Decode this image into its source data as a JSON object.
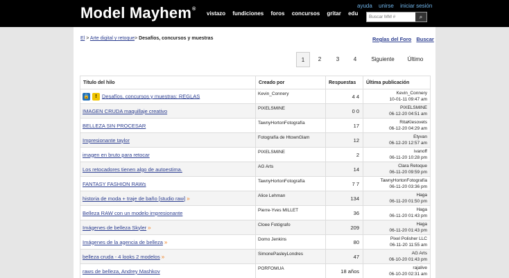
{
  "header": {
    "logo": "Model Mayhem",
    "logo_mark": "®",
    "nav": [
      "vistazo",
      "fundiciones",
      "foros",
      "concursos",
      "gritar",
      "edu"
    ],
    "util": [
      "ayuda",
      "unirse",
      "iniciar sesión"
    ],
    "search_placeholder": "Buscar MM #"
  },
  "breadcrumb": {
    "root": "El",
    "sep": ">",
    "section": "Arte digital y retoque",
    "current": "Desafíos, concursos y muestras"
  },
  "forum_links": {
    "rules": "Reglas del Foro",
    "search": "Buscar"
  },
  "pagination": {
    "pages": [
      "1",
      "2",
      "3",
      "4"
    ],
    "current": "1",
    "next": "Siguiente",
    "last": "Último"
  },
  "table": {
    "headers": {
      "title": "Título del hilo",
      "by": "Creado por",
      "replies": "Respuestas",
      "last": "Última publicación"
    },
    "rows": [
      {
        "title": "Desafíos, concursos y muestras: REGLAS",
        "by": "Kevin_Connery",
        "replies": "4 4",
        "last_user": "Kevin_Connery",
        "last_date": "10-01-11 09:47 am",
        "icons": true,
        "more": false
      },
      {
        "title": "IMAGEN CRUDA maquillaje creativo",
        "by": "PIXELSMINE",
        "replies": "0 0",
        "last_user": "PIXELSMINE",
        "last_date": "06-12-20 04:51 am",
        "icons": false,
        "more": false
      },
      {
        "title": "BELLEZA SIN PROCESAR",
        "by": "TawnyHortonFotografía",
        "replies": "17",
        "last_user": "RitaKlesovets",
        "last_date": "06-12-20 04:29 am",
        "icons": false,
        "more": false
      },
      {
        "title": "Impresionante taylor",
        "by": "Fotografía de HtownGlam",
        "replies": "12",
        "last_user": "Etyvan",
        "last_date": "06-12-20 12:57 am",
        "icons": false,
        "more": false
      },
      {
        "title": "imagen en bruto para retocar",
        "by": "PIXELSMINE",
        "replies": "2",
        "last_user": "ivanoff",
        "last_date": "06-11-20 10:28 pm",
        "icons": false,
        "more": false
      },
      {
        "title": "Los retocadores tienen algo de autoestima.",
        "by": "AG Arts",
        "replies": "14",
        "last_user": "Clara Retoque",
        "last_date": "06-11-20 09:59 pm",
        "icons": false,
        "more": false
      },
      {
        "title": "FANTASY FASHION RAWs",
        "by": "TawnyHortonFotografía",
        "replies": "7 7",
        "last_user": "TawnyHortonFotografía",
        "last_date": "06-11-20 03:36 pm",
        "icons": false,
        "more": false
      },
      {
        "title": "historia de moda + traje de baño [studio raw]",
        "by": "Alice Lehman",
        "replies": "134",
        "last_user": "Haga",
        "last_date": "06-11-20 01:50 pm",
        "icons": false,
        "more": true
      },
      {
        "title": "Belleza RAW con un modelo impresionante",
        "by": "Pierre-Yves MILLET",
        "replies": "36",
        "last_user": "Haga",
        "last_date": "06-11-20 01:43 pm",
        "icons": false,
        "more": false
      },
      {
        "title": "Imágenes de belleza Skyler",
        "by": "Cloee Fotógrafo",
        "replies": "209",
        "last_user": "Haga",
        "last_date": "06-11-20 01:43 pm",
        "icons": false,
        "more": true
      },
      {
        "title": "Imágenes de la agencia de belleza",
        "by": "Domo Jenkins",
        "replies": "80",
        "last_user": "Pixel Polisher LLC",
        "last_date": "06-11-20 11:55 am",
        "icons": false,
        "more": true
      },
      {
        "title": "belleza cruda - 4 looks 2 modelos",
        "by": "SimonePasleyLondres",
        "replies": "47",
        "last_user": "AG Arts",
        "last_date": "06-10-20 01:43 pm",
        "icons": false,
        "more": true
      },
      {
        "title": "raws de belleza, Andrey Mashkov",
        "by": "PORFOMUA",
        "replies": "18 años",
        "last_user": "rajalive",
        "last_date": "06-10-20 02:31 am",
        "icons": false,
        "more": false
      }
    ]
  }
}
